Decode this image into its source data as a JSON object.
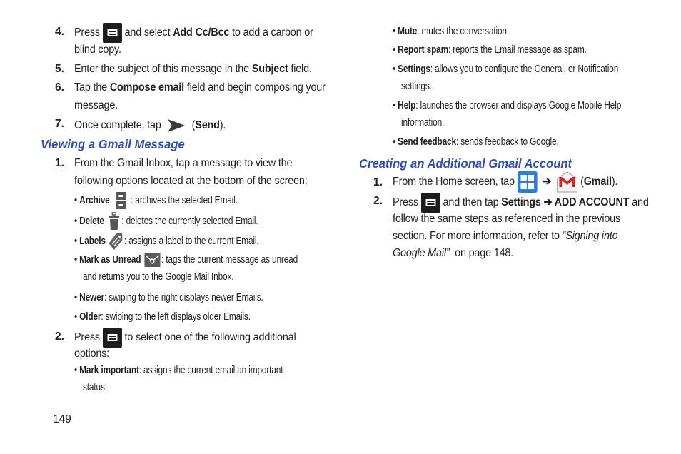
{
  "page_number": "149",
  "left": {
    "steps_top": [
      {
        "num": "4.",
        "lines": [
          {
            "parts": [
              {
                "t": "Press "
              },
              {
                "icon": "menu-key-icon"
              },
              {
                "t": " and select "
              },
              {
                "b": "Add Cc/Bcc"
              },
              {
                "t": " to add a carbon or"
              }
            ]
          },
          {
            "parts": [
              {
                "t": "blind copy."
              }
            ]
          }
        ]
      },
      {
        "num": "5.",
        "text_pre": "Enter the subject of this message in the ",
        "bold": "Subject",
        "text_post": " field."
      },
      {
        "num": "6.",
        "text_pre": "Tap the ",
        "bold": "Compose email",
        "text_post": " field and begin composing your",
        "line2": "message."
      },
      {
        "num": "7.",
        "text_pre": "Once complete, tap ",
        "bold": "Send",
        "text_post": ")."
      }
    ],
    "section_heading": "Viewing a Gmail Message",
    "step1": {
      "num": "1.",
      "line1": "From the Gmail Inbox, tap a message to view the",
      "line2": "following options located at the bottom of the screen:"
    },
    "bullets": [
      {
        "label": "Archive",
        "desc": ": archives the selected Email.",
        "icon": "archive-icon"
      },
      {
        "label": "Delete",
        "desc": ": deletes the currently selected Email.",
        "icon": "trash-icon"
      },
      {
        "label": "Labels",
        "desc": ": assigns a label to the current Email.",
        "icon": "label-tag-icon"
      },
      {
        "label": "Mark as Unread",
        "desc": ": tags the current message as unread",
        "desc2": "and returns you to the Google Mail Inbox.",
        "icon": "envelope-icon"
      },
      {
        "label": "Newer",
        "desc": ": swiping to the right displays newer Emails."
      },
      {
        "label": "Older",
        "desc": ": swiping to the left displays older Emails."
      }
    ],
    "step2": {
      "num": "2.",
      "pre": "Press ",
      "post": " to select one of the following additional",
      "line2": "options:"
    },
    "bullet_mark_important": {
      "label": "Mark important",
      "desc": ": assigns the current email an important",
      "desc2": "status."
    }
  },
  "right": {
    "bullets": [
      {
        "label": "Mute",
        "desc": ": mutes the conversation."
      },
      {
        "label": "Report spam",
        "desc": ": reports the Email message as spam."
      },
      {
        "label": "Settings",
        "desc": ": allows you to configure the General, or Notification",
        "desc2": "settings."
      },
      {
        "label": "Help",
        "desc": ": launches the browser and displays Google Mobile Help",
        "desc2": "information."
      },
      {
        "label": "Send feedback",
        "desc": ": sends feedback to Google."
      }
    ],
    "section_heading": "Creating an Additional Gmail Account",
    "step1": {
      "num": "1.",
      "pre": "From the Home screen, tap ",
      "arrow": "➔",
      "open": "(",
      "bold": "Gmail",
      "close": ")."
    },
    "step2": {
      "num": "2.",
      "pre": "Press ",
      "mid": " and then tap ",
      "bold1": "Settings",
      "arrow": " ➔ ",
      "bold2": "ADD ACCOUNT",
      "post": " and",
      "line2": "follow the same steps as referenced in the previous",
      "line3_pre": "section. For more information, refer to ",
      "line3_quote": "“Signing into",
      "line4_quote": "Google Mail”",
      "line4_post": "  on page 148."
    }
  },
  "colors": {
    "heading": "#2f4ea6",
    "text": "#231f20",
    "apps_icon_blue": "#2a7fd4",
    "gmail_red": "#d0272b"
  }
}
